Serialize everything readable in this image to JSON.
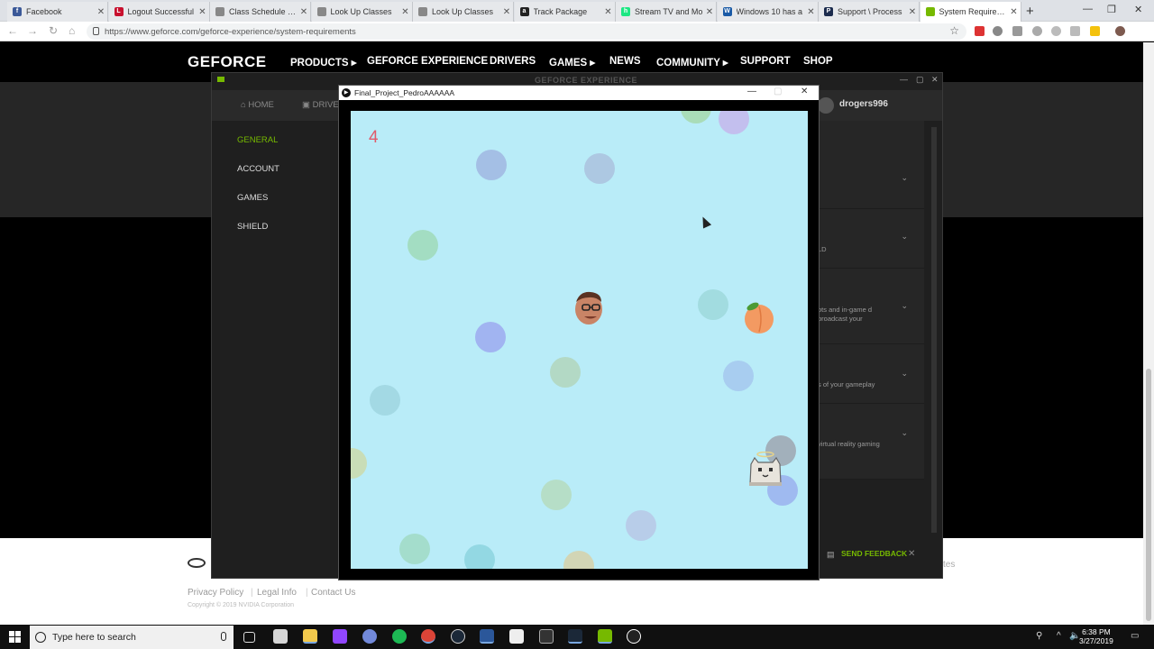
{
  "browser": {
    "tabs": [
      {
        "title": "Facebook",
        "icon": "facebook-icon",
        "color": "#3b5998",
        "glyph": "f"
      },
      {
        "title": "Logout Successful",
        "icon": "canvas-icon",
        "color": "#c8102e",
        "glyph": "L"
      },
      {
        "title": "Class Schedule List",
        "icon": "page-icon",
        "color": "#888888",
        "glyph": ""
      },
      {
        "title": "Look Up Classes",
        "icon": "page-icon",
        "color": "#888888",
        "glyph": ""
      },
      {
        "title": "Look Up Classes",
        "icon": "page-icon",
        "color": "#888888",
        "glyph": ""
      },
      {
        "title": "Track Package",
        "icon": "amazon-icon",
        "color": "#222222",
        "glyph": "a"
      },
      {
        "title": "Stream TV and Mo",
        "icon": "hulu-icon",
        "color": "#1ce783",
        "glyph": "h"
      },
      {
        "title": "Windows 10 has a",
        "icon": "news-icon",
        "color": "#1a5aa6",
        "glyph": "W"
      },
      {
        "title": "Support \\ Process",
        "icon": "paypal-icon",
        "color": "#1b2b4d",
        "glyph": "P"
      },
      {
        "title": "System Requireme",
        "icon": "nvidia-icon",
        "color": "#76b900",
        "glyph": ""
      }
    ],
    "url": "https://www.geforce.com/geforce-experience/system-requirements"
  },
  "site": {
    "logo": "GEFORCE",
    "nav": [
      "PRODUCTS",
      "GEFORCE EXPERIENCE",
      "DRIVERS",
      "GAMES",
      "NEWS",
      "COMMUNITY",
      "SUPPORT",
      "SHOP"
    ],
    "footer_links": [
      "Privacy Policy",
      "Legal Info",
      "Contact Us"
    ],
    "copyright": "Copyright © 2019 NVIDIA Corporation",
    "footer_right": "tes"
  },
  "gfe": {
    "title": "GEFORCE EXPERIENCE",
    "tabs": [
      "HOME",
      "DRIVE"
    ],
    "user": "drogers996",
    "sidebar": [
      "GENERAL",
      "ACCOUNT",
      "GAMES",
      "SHIELD"
    ],
    "panel_rows": [
      {
        "text": ""
      },
      {
        "text": "LD"
      },
      {
        "text": "ots and in-game d broadcast your"
      },
      {
        "text": "s of your gameplay"
      },
      {
        "text": "virtual reality gaming"
      }
    ],
    "feedback": "SEND FEEDBACK"
  },
  "game": {
    "title": "Final_Project_PedroAAAAAA",
    "score": "4",
    "sprites": {
      "player": "face-sprite",
      "fruit": "peach-sprite",
      "enemy": "ghost-cat-sprite"
    },
    "bubble_colors": [
      "#9fb4e0",
      "#9ed6c2",
      "#a8c6e6",
      "#b7b2e8",
      "#a5d2c0",
      "#c9d9b4"
    ]
  },
  "taskbar": {
    "search_placeholder": "Type here to search",
    "time": "6:38 PM",
    "date": "3/27/2019"
  }
}
